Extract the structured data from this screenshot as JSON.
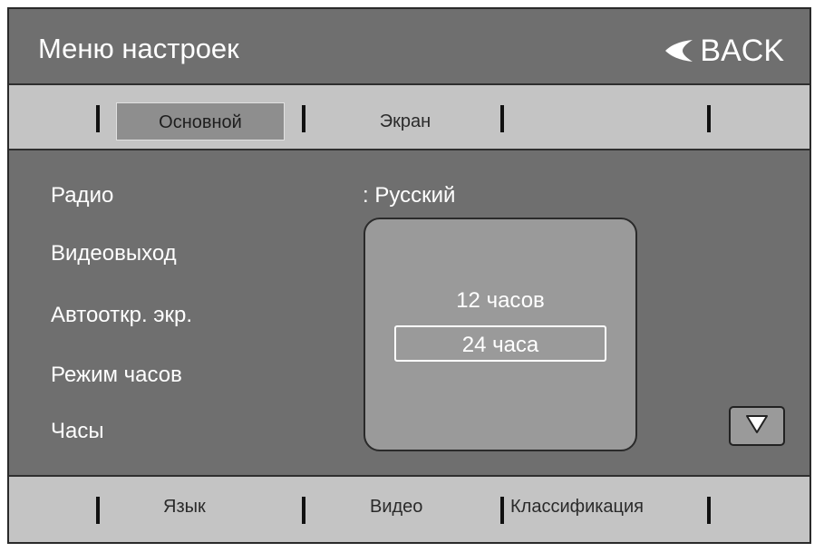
{
  "header": {
    "title": "Меню настроек",
    "back_label": "BACK"
  },
  "tabs": {
    "main": "Основной",
    "screen": "Экран"
  },
  "settings": {
    "items": [
      "Радио",
      "Видеовыход",
      "Автооткр. экр.",
      "Режим часов",
      "Часы"
    ],
    "language_value": ": Русский"
  },
  "clock_popup": {
    "options": [
      "12 часов",
      "24 часа"
    ],
    "selected": "24 часа"
  },
  "footer": {
    "tabs": [
      "Язык",
      "Видео",
      "Классификация"
    ]
  },
  "colors": {
    "screen_bg": "#6f6f6f",
    "bar_bg": "#c4c4c4",
    "popup_bg": "#9a9a9a"
  },
  "icons": {
    "back": "back-arrow-icon",
    "scroll_down": "triangle-down-icon"
  }
}
